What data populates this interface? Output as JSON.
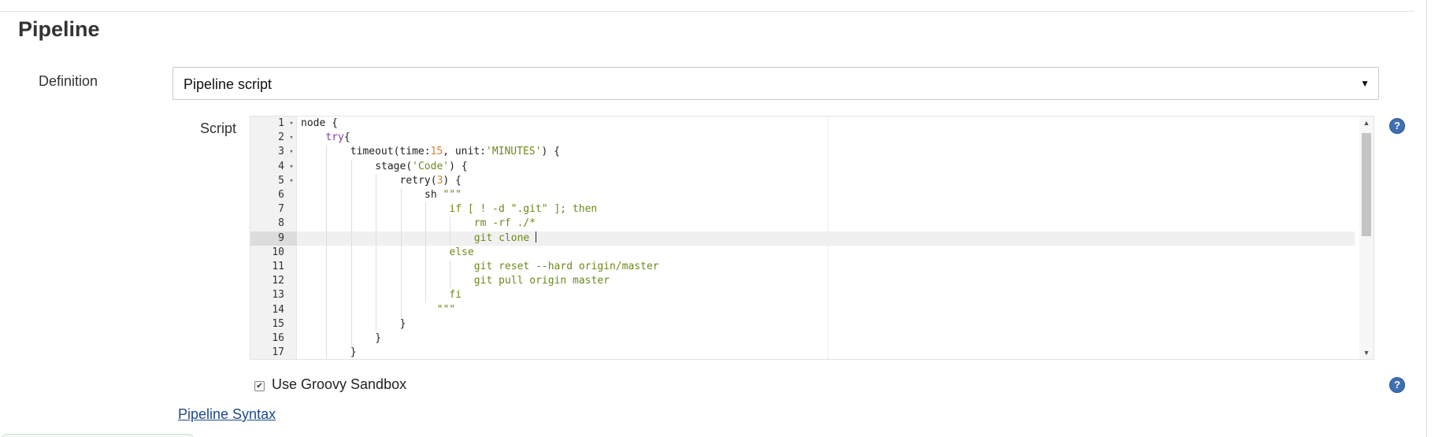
{
  "section": {
    "title": "Pipeline"
  },
  "definition": {
    "label": "Definition",
    "selected": "Pipeline script"
  },
  "script": {
    "label": "Script",
    "lines": [
      {
        "n": "1",
        "fold": "▾",
        "indent": 0,
        "parts": [
          [
            "plain",
            "node {"
          ]
        ]
      },
      {
        "n": "2",
        "fold": "▾",
        "indent": 1,
        "parts": [
          [
            "kw",
            "try"
          ],
          [
            "plain",
            "{"
          ]
        ]
      },
      {
        "n": "3",
        "fold": "▾",
        "indent": 2,
        "parts": [
          [
            "plain",
            "timeout(time:"
          ],
          [
            "num",
            "15"
          ],
          [
            "plain",
            ", unit:"
          ],
          [
            "str",
            "'MINUTES'"
          ],
          [
            "plain",
            ") {"
          ]
        ]
      },
      {
        "n": "4",
        "fold": "▾",
        "indent": 3,
        "parts": [
          [
            "plain",
            "stage("
          ],
          [
            "str",
            "'Code'"
          ],
          [
            "plain",
            ") {"
          ]
        ]
      },
      {
        "n": "5",
        "fold": "▾",
        "indent": 4,
        "parts": [
          [
            "plain",
            "retry("
          ],
          [
            "num",
            "3"
          ],
          [
            "plain",
            ") {"
          ]
        ]
      },
      {
        "n": "6",
        "fold": "",
        "indent": 5,
        "parts": [
          [
            "plain",
            "sh "
          ],
          [
            "str",
            "\"\"\""
          ]
        ]
      },
      {
        "n": "7",
        "fold": "",
        "indent": 6,
        "parts": [
          [
            "str",
            "if [ ! -d \".git\" ]; then"
          ]
        ]
      },
      {
        "n": "8",
        "fold": "",
        "indent": 7,
        "parts": [
          [
            "str",
            "rm -rf ./*"
          ]
        ]
      },
      {
        "n": "9",
        "fold": "",
        "indent": 7,
        "parts": [
          [
            "str",
            "git clone "
          ]
        ],
        "active": true
      },
      {
        "n": "10",
        "fold": "",
        "indent": 6,
        "parts": [
          [
            "str",
            "else"
          ]
        ]
      },
      {
        "n": "11",
        "fold": "",
        "indent": 7,
        "parts": [
          [
            "str",
            "git reset --hard origin/master"
          ]
        ]
      },
      {
        "n": "12",
        "fold": "",
        "indent": 7,
        "parts": [
          [
            "str",
            "git pull origin master"
          ]
        ]
      },
      {
        "n": "13",
        "fold": "",
        "indent": 6,
        "parts": [
          [
            "str",
            "fi"
          ]
        ]
      },
      {
        "n": "14",
        "fold": "",
        "indent": 5,
        "parts": [
          [
            "plain",
            "  "
          ],
          [
            "str",
            "\"\"\""
          ]
        ]
      },
      {
        "n": "15",
        "fold": "",
        "indent": 4,
        "parts": [
          [
            "plain",
            "}"
          ]
        ]
      },
      {
        "n": "16",
        "fold": "",
        "indent": 3,
        "parts": [
          [
            "plain",
            "}"
          ]
        ]
      },
      {
        "n": "17",
        "fold": "",
        "indent": 2,
        "parts": [
          [
            "plain",
            "}"
          ]
        ]
      }
    ]
  },
  "sandbox": {
    "label": "Use Groovy Sandbox",
    "checked": true
  },
  "links": {
    "syntax": "Pipeline Syntax"
  },
  "icons": {
    "help": "help-icon",
    "dropdown": "chevron-down-icon",
    "fold": "fold-arrow-icon"
  },
  "colors": {
    "keyword": "#7a3e9d",
    "string": "#6a8a1a",
    "number": "#d9822b",
    "help": "#3f6fb3",
    "link": "#204a87"
  }
}
